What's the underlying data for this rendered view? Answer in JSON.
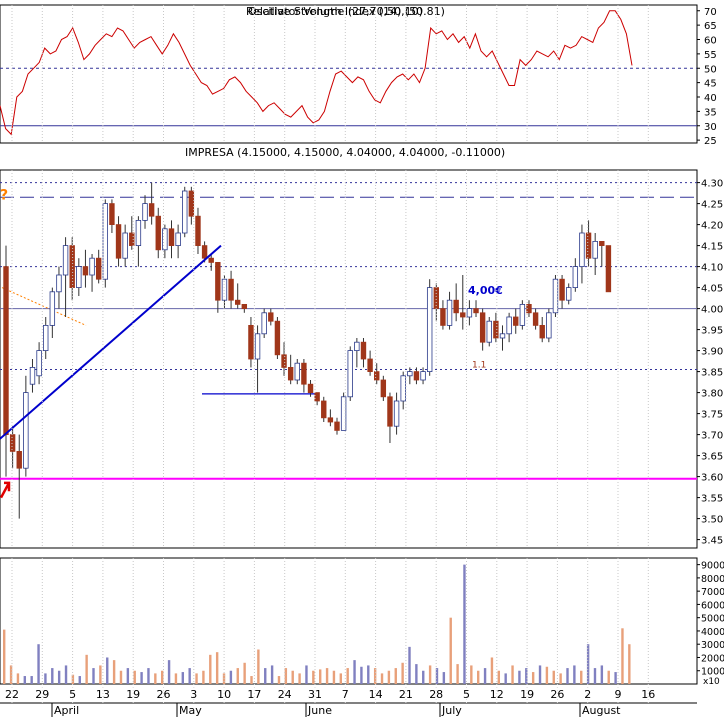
{
  "colors": {
    "rsi_line": "#cc0000",
    "up_candle": "#ffffff",
    "down_candle": "#a0361a",
    "candle_outline": "#333333",
    "trend_line": "#0000cc",
    "support_line": "#ff00ff",
    "vol_up": "#e8a07a",
    "vol_down": "#8080c0",
    "dash_line": "#333399",
    "arrow": "#e00000",
    "question": "#ff8000"
  },
  "chart_data": [
    {
      "type": "line",
      "title": "Relative Strength Index (14) (50.81)",
      "overlay_text": "Oscillator Volume (27,70,50,10)",
      "y_ticks": [
        25,
        30,
        35,
        40,
        45,
        50,
        55,
        60,
        65,
        70
      ],
      "ylim": [
        24,
        72
      ],
      "reference_lines": [
        50,
        30
      ],
      "grid": "vertical dotted",
      "series": [
        {
          "values": [
            37,
            29,
            27,
            40,
            42,
            48,
            50,
            52,
            57,
            55,
            56,
            60,
            61,
            64,
            59,
            53,
            55,
            58,
            60,
            62,
            61,
            64,
            63,
            60,
            57,
            59,
            60,
            61,
            58,
            55,
            58,
            62,
            59,
            55,
            51,
            48,
            45,
            44,
            41,
            42,
            43,
            46,
            47,
            45,
            42,
            40,
            38,
            35,
            37,
            38,
            36,
            34,
            33,
            35,
            37,
            33,
            31,
            32,
            35,
            42,
            48,
            49,
            47,
            45,
            47,
            46,
            42,
            39,
            38,
            42,
            45,
            47,
            48,
            46,
            48,
            45,
            50,
            64,
            62,
            63,
            60,
            62,
            59,
            61,
            57,
            62,
            56,
            54,
            56,
            52,
            48,
            44,
            44,
            53,
            51,
            53,
            56,
            55,
            54,
            56,
            53,
            58,
            57,
            58,
            61,
            60,
            59,
            64,
            66,
            70,
            70,
            67,
            62,
            51
          ]
        }
      ]
    },
    {
      "type": "candlestick",
      "title": "IMPRESA (4.15000, 4.15000, 4.04000, 4.04000, -0.11000)",
      "y_ticks": [
        3.45,
        3.5,
        3.55,
        3.6,
        3.65,
        3.7,
        3.75,
        3.8,
        3.85,
        3.9,
        3.95,
        4.0,
        4.05,
        4.1,
        4.15,
        4.2,
        4.25,
        4.3
      ],
      "ylim": [
        3.43,
        4.33
      ],
      "annotations": [
        "?",
        "4,00€",
        "1.1"
      ],
      "horizontal_lines": {
        "dashed_resistance": 4.265,
        "dotted_levels": [
          4.3,
          4.1,
          3.855
        ],
        "solid_level": 4.0,
        "support_magenta": 3.595,
        "short_blue": 3.797
      },
      "trend_line": {
        "from": [
          1,
          3.69
        ],
        "to": [
          36,
          4.15
        ]
      },
      "candles": [
        {
          "o": 4.1,
          "h": 4.15,
          "l": 3.6,
          "c": 3.7
        },
        {
          "o": 3.7,
          "h": 3.72,
          "l": 3.62,
          "c": 3.66
        },
        {
          "o": 3.66,
          "h": 3.7,
          "l": 3.5,
          "c": 3.62
        },
        {
          "o": 3.62,
          "h": 3.84,
          "l": 3.6,
          "c": 3.8
        },
        {
          "o": 3.82,
          "h": 3.88,
          "l": 3.8,
          "c": 3.86
        },
        {
          "o": 3.84,
          "h": 3.92,
          "l": 3.82,
          "c": 3.9
        },
        {
          "o": 3.9,
          "h": 3.98,
          "l": 3.88,
          "c": 3.96
        },
        {
          "o": 3.96,
          "h": 4.05,
          "l": 3.93,
          "c": 4.04
        },
        {
          "o": 4.04,
          "h": 4.1,
          "l": 4.0,
          "c": 4.08
        },
        {
          "o": 4.08,
          "h": 4.17,
          "l": 3.98,
          "c": 4.15
        },
        {
          "o": 4.15,
          "h": 4.17,
          "l": 4.02,
          "c": 4.05
        },
        {
          "o": 4.05,
          "h": 4.12,
          "l": 4.03,
          "c": 4.1
        },
        {
          "o": 4.1,
          "h": 4.14,
          "l": 4.05,
          "c": 4.08
        },
        {
          "o": 4.08,
          "h": 4.13,
          "l": 4.04,
          "c": 4.12
        },
        {
          "o": 4.12,
          "h": 4.14,
          "l": 4.06,
          "c": 4.07
        },
        {
          "o": 4.07,
          "h": 4.26,
          "l": 4.05,
          "c": 4.25
        },
        {
          "o": 4.25,
          "h": 4.26,
          "l": 4.18,
          "c": 4.2
        },
        {
          "o": 4.2,
          "h": 4.22,
          "l": 4.1,
          "c": 4.12
        },
        {
          "o": 4.12,
          "h": 4.2,
          "l": 4.1,
          "c": 4.18
        },
        {
          "o": 4.18,
          "h": 4.22,
          "l": 4.14,
          "c": 4.15
        },
        {
          "o": 4.15,
          "h": 4.22,
          "l": 4.1,
          "c": 4.21
        },
        {
          "o": 4.21,
          "h": 4.27,
          "l": 4.19,
          "c": 4.25
        },
        {
          "o": 4.25,
          "h": 4.3,
          "l": 4.2,
          "c": 4.22
        },
        {
          "o": 4.22,
          "h": 4.24,
          "l": 4.12,
          "c": 4.14
        },
        {
          "o": 4.14,
          "h": 4.2,
          "l": 4.12,
          "c": 4.19
        },
        {
          "o": 4.19,
          "h": 4.21,
          "l": 4.12,
          "c": 4.15
        },
        {
          "o": 4.15,
          "h": 4.2,
          "l": 4.12,
          "c": 4.18
        },
        {
          "o": 4.18,
          "h": 4.29,
          "l": 4.17,
          "c": 4.28
        },
        {
          "o": 4.28,
          "h": 4.29,
          "l": 4.2,
          "c": 4.22
        },
        {
          "o": 4.22,
          "h": 4.24,
          "l": 4.13,
          "c": 4.15
        },
        {
          "o": 4.15,
          "h": 4.16,
          "l": 4.11,
          "c": 4.12
        },
        {
          "o": 4.12,
          "h": 4.13,
          "l": 4.09,
          "c": 4.11
        },
        {
          "o": 4.11,
          "h": 4.11,
          "l": 3.99,
          "c": 4.02
        },
        {
          "o": 4.02,
          "h": 4.08,
          "l": 4.0,
          "c": 4.07
        },
        {
          "o": 4.07,
          "h": 4.09,
          "l": 4.0,
          "c": 4.02
        },
        {
          "o": 4.02,
          "h": 4.06,
          "l": 4.0,
          "c": 4.01
        },
        {
          "o": 4.01,
          "h": 4.01,
          "l": 3.99,
          "c": 4.0
        },
        {
          "o": 3.96,
          "h": 3.98,
          "l": 3.86,
          "c": 3.88
        },
        {
          "o": 3.88,
          "h": 3.96,
          "l": 3.8,
          "c": 3.94
        },
        {
          "o": 3.94,
          "h": 4.0,
          "l": 3.93,
          "c": 3.99
        },
        {
          "o": 3.99,
          "h": 4.0,
          "l": 3.96,
          "c": 3.97
        },
        {
          "o": 3.97,
          "h": 3.98,
          "l": 3.88,
          "c": 3.89
        },
        {
          "o": 3.89,
          "h": 3.92,
          "l": 3.84,
          "c": 3.86
        },
        {
          "o": 3.86,
          "h": 3.89,
          "l": 3.82,
          "c": 3.83
        },
        {
          "o": 3.83,
          "h": 3.88,
          "l": 3.82,
          "c": 3.87
        },
        {
          "o": 3.87,
          "h": 3.88,
          "l": 3.8,
          "c": 3.82
        },
        {
          "o": 3.82,
          "h": 3.83,
          "l": 3.79,
          "c": 3.8
        },
        {
          "o": 3.8,
          "h": 3.8,
          "l": 3.77,
          "c": 3.78
        },
        {
          "o": 3.78,
          "h": 3.79,
          "l": 3.73,
          "c": 3.74
        },
        {
          "o": 3.74,
          "h": 3.76,
          "l": 3.72,
          "c": 3.73
        },
        {
          "o": 3.73,
          "h": 3.74,
          "l": 3.7,
          "c": 3.71
        },
        {
          "o": 3.71,
          "h": 3.8,
          "l": 3.71,
          "c": 3.79
        },
        {
          "o": 3.79,
          "h": 3.91,
          "l": 3.78,
          "c": 3.9
        },
        {
          "o": 3.9,
          "h": 3.93,
          "l": 3.86,
          "c": 3.92
        },
        {
          "o": 3.92,
          "h": 3.93,
          "l": 3.86,
          "c": 3.88
        },
        {
          "o": 3.88,
          "h": 3.9,
          "l": 3.84,
          "c": 3.85
        },
        {
          "o": 3.85,
          "h": 3.87,
          "l": 3.82,
          "c": 3.83
        },
        {
          "o": 3.83,
          "h": 3.84,
          "l": 3.78,
          "c": 3.79
        },
        {
          "o": 3.79,
          "h": 3.8,
          "l": 3.68,
          "c": 3.72
        },
        {
          "o": 3.72,
          "h": 3.8,
          "l": 3.7,
          "c": 3.78
        },
        {
          "o": 3.78,
          "h": 3.85,
          "l": 3.76,
          "c": 3.84
        },
        {
          "o": 3.84,
          "h": 3.86,
          "l": 3.82,
          "c": 3.85
        },
        {
          "o": 3.85,
          "h": 3.86,
          "l": 3.82,
          "c": 3.83
        },
        {
          "o": 3.83,
          "h": 3.86,
          "l": 3.82,
          "c": 3.85
        },
        {
          "o": 3.85,
          "h": 4.07,
          "l": 3.84,
          "c": 4.05
        },
        {
          "o": 4.05,
          "h": 4.06,
          "l": 3.97,
          "c": 4.0
        },
        {
          "o": 4.0,
          "h": 4.02,
          "l": 3.95,
          "c": 3.96
        },
        {
          "o": 3.96,
          "h": 4.04,
          "l": 3.95,
          "c": 4.02
        },
        {
          "o": 4.02,
          "h": 4.06,
          "l": 3.97,
          "c": 3.99
        },
        {
          "o": 3.99,
          "h": 4.08,
          "l": 3.95,
          "c": 3.98
        },
        {
          "o": 3.98,
          "h": 4.02,
          "l": 3.96,
          "c": 4.0
        },
        {
          "o": 4.0,
          "h": 4.02,
          "l": 3.98,
          "c": 3.99
        },
        {
          "o": 3.99,
          "h": 4.0,
          "l": 3.9,
          "c": 3.92
        },
        {
          "o": 3.92,
          "h": 3.98,
          "l": 3.91,
          "c": 3.97
        },
        {
          "o": 3.97,
          "h": 3.99,
          "l": 3.92,
          "c": 3.93
        },
        {
          "o": 3.93,
          "h": 3.96,
          "l": 3.9,
          "c": 3.94
        },
        {
          "o": 3.94,
          "h": 3.99,
          "l": 3.92,
          "c": 3.98
        },
        {
          "o": 3.98,
          "h": 4.0,
          "l": 3.94,
          "c": 3.96
        },
        {
          "o": 3.96,
          "h": 4.02,
          "l": 3.95,
          "c": 4.01
        },
        {
          "o": 4.01,
          "h": 4.02,
          "l": 3.98,
          "c": 3.99
        },
        {
          "o": 3.99,
          "h": 4.0,
          "l": 3.95,
          "c": 3.96
        },
        {
          "o": 3.96,
          "h": 3.98,
          "l": 3.92,
          "c": 3.93
        },
        {
          "o": 3.93,
          "h": 4.0,
          "l": 3.92,
          "c": 3.99
        },
        {
          "o": 3.99,
          "h": 4.08,
          "l": 3.98,
          "c": 4.07
        },
        {
          "o": 4.07,
          "h": 4.08,
          "l": 4.0,
          "c": 4.02
        },
        {
          "o": 4.02,
          "h": 4.06,
          "l": 4.01,
          "c": 4.05
        },
        {
          "o": 4.05,
          "h": 4.12,
          "l": 4.04,
          "c": 4.1
        },
        {
          "o": 4.1,
          "h": 4.2,
          "l": 4.06,
          "c": 4.18
        },
        {
          "o": 4.18,
          "h": 4.21,
          "l": 4.1,
          "c": 4.12
        },
        {
          "o": 4.12,
          "h": 4.18,
          "l": 4.08,
          "c": 4.16
        },
        {
          "o": 4.16,
          "h": 4.16,
          "l": 4.1,
          "c": 4.15
        },
        {
          "o": 4.15,
          "h": 4.15,
          "l": 4.04,
          "c": 4.04
        }
      ]
    },
    {
      "type": "bar",
      "title": "Volume",
      "y_ticks": [
        10000,
        20000,
        30000,
        40000,
        50000,
        60000,
        70000,
        80000,
        90000
      ],
      "ylim": [
        0,
        95000
      ],
      "multiplier_label": "x10",
      "x_tick_labels": [
        "22",
        "29",
        "5",
        "13",
        "19",
        "26",
        "3",
        "10",
        "17",
        "24",
        "31",
        "7",
        "14",
        "21",
        "28",
        "5",
        "12",
        "19",
        "26",
        "2",
        "9",
        "16"
      ],
      "month_labels": [
        "April",
        "May",
        "June",
        "July",
        "August"
      ],
      "values": [
        41000,
        14000,
        8000,
        6000,
        6000,
        30000,
        8000,
        12000,
        10000,
        14000,
        7000,
        6000,
        22000,
        12000,
        14000,
        20000,
        18000,
        10000,
        12000,
        10000,
        9000,
        12000,
        8000,
        10000,
        18000,
        8000,
        9000,
        12000,
        8000,
        10000,
        22000,
        24000,
        8000,
        10000,
        12000,
        16000,
        6000,
        26000,
        12000,
        14000,
        6000,
        12000,
        10000,
        8000,
        14000,
        10000,
        11000,
        12000,
        10000,
        8000,
        12000,
        18000,
        13000,
        14000,
        12000,
        8000,
        10000,
        12000,
        16000,
        28000,
        15000,
        10000,
        14000,
        12000,
        9000,
        50000,
        15000,
        90000,
        14000,
        10000,
        12000,
        20000,
        10000,
        8000,
        14000,
        10000,
        12000,
        9000,
        14000,
        13000,
        10000,
        8000,
        12000,
        14000,
        10000,
        30000,
        12000,
        14000,
        10000,
        9000,
        42000,
        30000
      ]
    }
  ]
}
